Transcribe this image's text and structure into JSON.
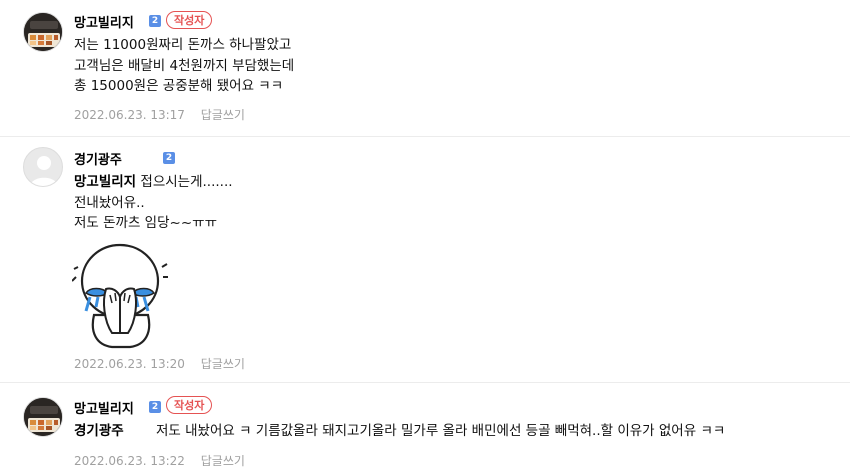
{
  "comments": [
    {
      "author": "망고빌리지",
      "level": "2",
      "writer_badge": "작성자",
      "lines": [
        "저는 11000원짜리 돈까스 하나팔았고",
        "고객님은 배달비 4천원까지 부담했는데",
        "총 15000원은 공중분해 됐어요 ㅋㅋ"
      ],
      "date": "2022.06.23. 13:17",
      "reply_label": "답글쓰기"
    },
    {
      "author": "경기광주",
      "level": "2",
      "mention": "망고빌리지",
      "first_line": "접으시는게.......",
      "lines": [
        "전내놨어유..",
        "저도 돈까츠 임당~~ㅠㅠ"
      ],
      "sticker": "crying-face-sticker",
      "date": "2022.06.23. 13:20",
      "reply_label": "답글쓰기"
    },
    {
      "author": "망고빌리지",
      "level": "2",
      "writer_badge": "작성자",
      "mention": "경기광주",
      "first_line": "저도 내놨어요 ㅋ 기름값올라 돼지고기올라 밀가루 올라 배민에선 등골 빼먹혀..할 이유가 없어유 ㅋㅋ",
      "date": "2022.06.23. 13:22",
      "reply_label": "답글쓰기"
    }
  ],
  "colors": {
    "writer_badge": "#e55353",
    "level_badge": "#5a8fe6",
    "meta_text": "#a0a0a0"
  }
}
